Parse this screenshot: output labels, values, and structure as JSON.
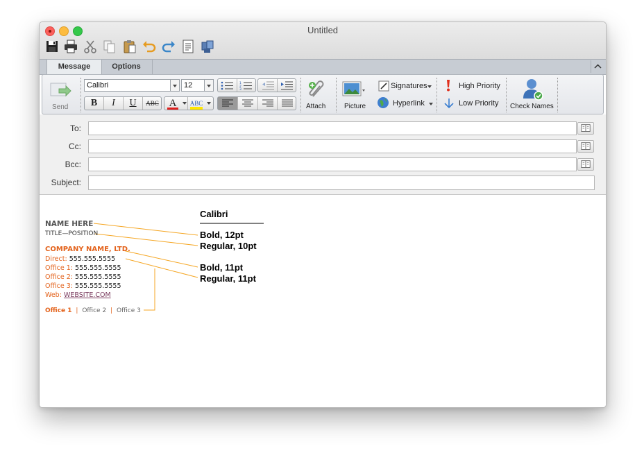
{
  "window": {
    "title": "Untitled"
  },
  "quick_toolbar": [
    "save-icon",
    "print-icon",
    "cut-icon",
    "copy-icon",
    "paste-icon",
    "undo-icon",
    "redo-icon",
    "format-painter-icon",
    "address-book-icon"
  ],
  "tabs": [
    {
      "label": "Message",
      "active": true
    },
    {
      "label": "Options",
      "active": false
    }
  ],
  "ribbon": {
    "send_label": "Send",
    "font_name": "Calibri",
    "font_size": "12",
    "attach_label": "Attach",
    "picture_label": "Picture",
    "signatures_label": "Signatures",
    "hyperlink_label": "Hyperlink",
    "high_priority_label": "High Priority",
    "low_priority_label": "Low Priority",
    "check_names_label": "Check Names"
  },
  "header": {
    "to_label": "To:",
    "cc_label": "Cc:",
    "bcc_label": "Bcc:",
    "subject_label": "Subject:",
    "to_value": "",
    "cc_value": "",
    "bcc_value": "",
    "subject_value": ""
  },
  "signature": {
    "name": "NAME HERE",
    "title": "TITLE—POSITION",
    "company": "COMPANY NAME, LTD.",
    "direct_label": "Direct:",
    "direct_value": "555.555.5555",
    "office1_label": "Office 1:",
    "office1_value": "555.555.5555",
    "office2_label": "Office 2:",
    "office2_value": "555.555.5555",
    "office3_label": "Office 3:",
    "office3_value": "555.555.5555",
    "web_label": "Web:",
    "web_value": "WEBSITE.COM",
    "offices": [
      "Office 1",
      "Office 2",
      "Office 3"
    ],
    "separator": "|"
  },
  "annotations": {
    "font_title": "Calibri",
    "a1": "Bold, 12pt",
    "a2": "Regular, 10pt",
    "a3": "Bold, 11pt",
    "a4": "Regular, 11pt"
  },
  "colors": {
    "accent_orange": "#e3621b",
    "leader_orange": "#f5a623",
    "link_purple": "#7a3b5e",
    "text_gray": "#555555"
  }
}
